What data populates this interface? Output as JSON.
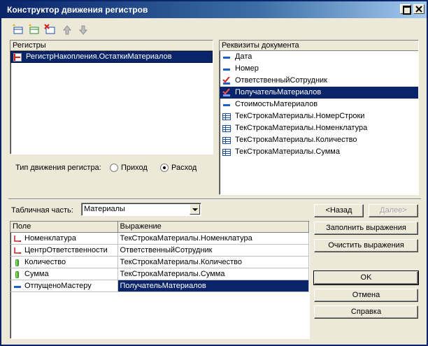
{
  "window": {
    "title": "Конструктор движения регистров"
  },
  "toolbar": {
    "buttons": [
      "add-icon",
      "add-register-icon",
      "delete-icon",
      "move-up-icon",
      "move-down-icon"
    ]
  },
  "registers": {
    "header": "Регистры",
    "items": [
      {
        "label": "РегистрНакопления.ОстаткиМатериалов",
        "selected": true
      }
    ]
  },
  "movement_type": {
    "label": "Тип движения регистра:",
    "options": [
      "Приход",
      "Расход"
    ],
    "selected": "Расход"
  },
  "requisites": {
    "header": "Реквизиты документа",
    "items": [
      {
        "label": "Дата",
        "icon": "attribute-icon"
      },
      {
        "label": "Номер",
        "icon": "attribute-icon"
      },
      {
        "label": "ОтветственныйСотрудник",
        "icon": "checked-attribute-icon"
      },
      {
        "label": "ПолучательМатериалов",
        "icon": "checked-attribute-icon",
        "selected": true
      },
      {
        "label": "СтоимостьМатериалов",
        "icon": "attribute-icon"
      },
      {
        "label": "ТекСтрокаМатериалы.НомерСтроки",
        "icon": "table-icon"
      },
      {
        "label": "ТекСтрокаМатериалы.Номенклатура",
        "icon": "table-icon"
      },
      {
        "label": "ТекСтрокаМатериалы.Количество",
        "icon": "table-icon"
      },
      {
        "label": "ТекСтрокаМатериалы.Сумма",
        "icon": "table-icon"
      }
    ]
  },
  "tabular_part": {
    "label": "Табличная часть:",
    "value": "Материалы"
  },
  "expressions": {
    "columns": [
      "Поле",
      "Выражение"
    ],
    "rows": [
      {
        "field": "Номенклатура",
        "expr": "ТекСтрокаМатериалы.Номенклатура",
        "icon": "dimension-icon"
      },
      {
        "field": "ЦентрОтветственности",
        "expr": "ОтветственныйСотрудник",
        "icon": "dimension-icon"
      },
      {
        "field": "Количество",
        "expr": "ТекСтрокаМатериалы.Количество",
        "icon": "resource-icon"
      },
      {
        "field": "Сумма",
        "expr": "ТекСтрокаМатериалы.Сумма",
        "icon": "resource-icon"
      },
      {
        "field": "ОтпущеноМастеру",
        "expr": "ПолучательМатериалов",
        "icon": "attribute-icon",
        "selected": true
      }
    ]
  },
  "buttons": {
    "back": "<Назад",
    "next": "Далее>",
    "fill": "Заполнить выражения",
    "clear": "Очистить выражения",
    "ok": "OK",
    "cancel": "Отмена",
    "help": "Справка"
  },
  "colors": {
    "selection": "#0a246a",
    "face": "#ece9d8",
    "attribute": "#1f5fc8",
    "dimension": "#c02020",
    "resource": "#3c9a1e"
  }
}
